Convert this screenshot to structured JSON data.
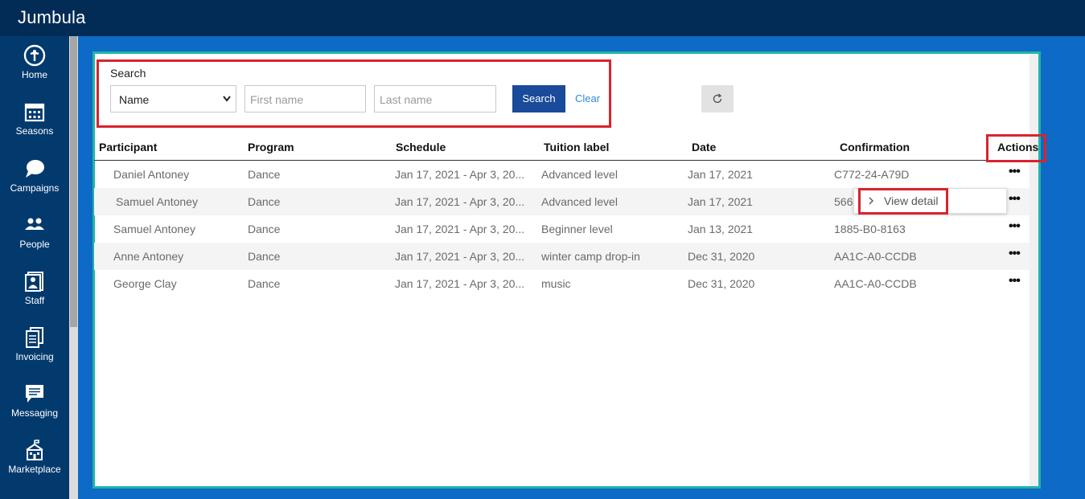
{
  "app": {
    "title": "Jumbula"
  },
  "sidebar": {
    "items": [
      {
        "label": "Home",
        "icon": "info-circle-icon"
      },
      {
        "label": "Seasons",
        "icon": "calendar-icon"
      },
      {
        "label": "Campaigns",
        "icon": "chat-bubble-icon"
      },
      {
        "label": "People",
        "icon": "people-icon"
      },
      {
        "label": "Staff",
        "icon": "staff-card-icon"
      },
      {
        "label": "Invoicing",
        "icon": "invoice-icon"
      },
      {
        "label": "Messaging",
        "icon": "message-icon"
      },
      {
        "label": "Marketplace",
        "icon": "school-icon"
      }
    ]
  },
  "search": {
    "label": "Search",
    "select_value": "Name",
    "first_name_placeholder": "First name",
    "last_name_placeholder": "Last name",
    "search_button": "Search",
    "clear_link": "Clear",
    "refresh_icon": "refresh-icon"
  },
  "table": {
    "headers": [
      "Participant",
      "Program",
      "Schedule",
      "Tuition label",
      "Date",
      "Confirmation",
      "Actions"
    ],
    "rows": [
      {
        "participant": "Daniel Antoney",
        "program": "Dance",
        "schedule": "Jan 17, 2021 - Apr 3, 20...",
        "tuition": "Advanced level",
        "date": "Jan 17, 2021",
        "confirmation": "C772-24-A79D",
        "actions": "•••"
      },
      {
        "participant": "Samuel Antoney",
        "program": "Dance",
        "schedule": "Jan 17, 2021 - Apr 3, 20...",
        "tuition": "Advanced level",
        "date": "Jan 17, 2021",
        "confirmation": "566",
        "actions": "•••"
      },
      {
        "participant": "Samuel Antoney",
        "program": "Dance",
        "schedule": "Jan 17, 2021 - Apr 3, 20...",
        "tuition": "Beginner level",
        "date": "Jan 13, 2021",
        "confirmation": "1885-B0-8163",
        "actions": "•••"
      },
      {
        "participant": "Anne Antoney",
        "program": "Dance",
        "schedule": "Jan 17, 2021 - Apr 3, 20...",
        "tuition": "winter camp drop-in",
        "date": "Dec 31, 2020",
        "confirmation": "AA1C-A0-CCDB",
        "actions": "•••"
      },
      {
        "participant": "George Clay",
        "program": "Dance",
        "schedule": "Jan 17, 2021 - Apr 3, 20...",
        "tuition": "music",
        "date": "Dec 31, 2020",
        "confirmation": "AA1C-A0-CCDB",
        "actions": "•••"
      }
    ]
  },
  "popover": {
    "view_detail": "View detail"
  },
  "colors": {
    "topbar": "#022c56",
    "sidebar": "#033a6e",
    "background": "#0d6ac6",
    "panel_border": "#1fb5a8",
    "highlight": "#d9232e",
    "button": "#1a4a9a"
  }
}
